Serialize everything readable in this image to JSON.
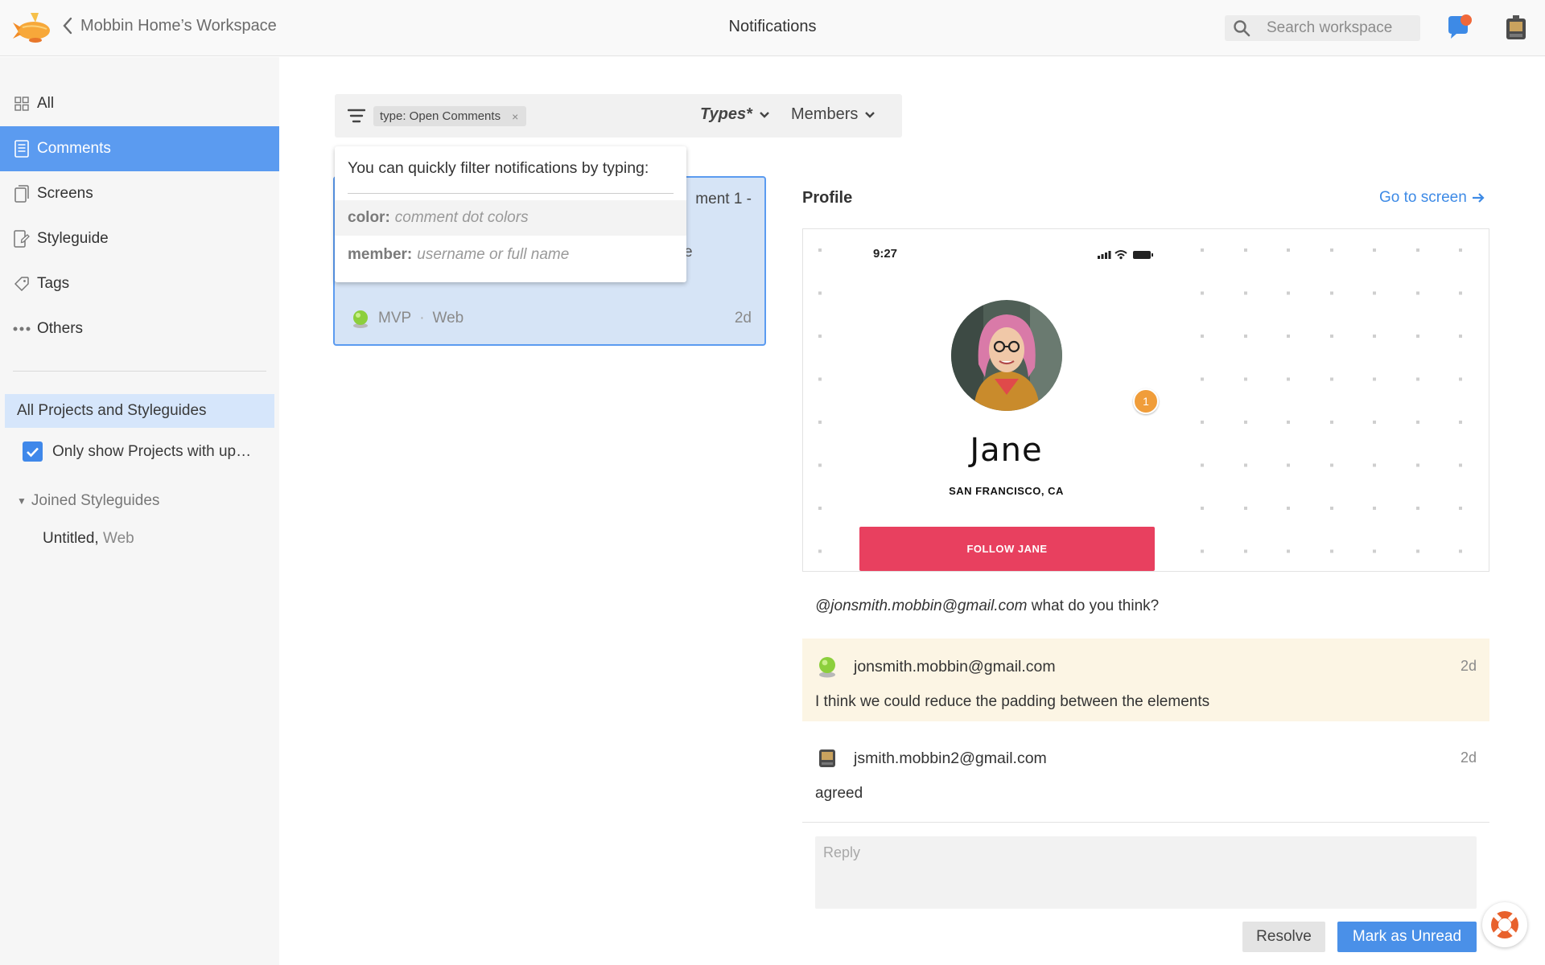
{
  "topbar": {
    "back_label": "Mobbin Home’s Workspace",
    "title": "Notifications",
    "search_placeholder": "Search workspace"
  },
  "sidebar": {
    "items": [
      {
        "label": "All",
        "icon": "grid-icon"
      },
      {
        "label": "Comments",
        "icon": "document-icon",
        "active": true
      },
      {
        "label": "Screens",
        "icon": "screens-icon"
      },
      {
        "label": "Styleguide",
        "icon": "styleguide-icon"
      },
      {
        "label": "Tags",
        "icon": "tag-icon"
      },
      {
        "label": "Others",
        "icon": "more-icon"
      }
    ],
    "projects_button": "All Projects and Styleguides",
    "only_show": "Only show Projects with up…",
    "joined_label": "Joined Styleguides",
    "styleguide_name": "Untitled,",
    "styleguide_platform": " Web"
  },
  "filter": {
    "chip": "type: Open Comments",
    "chip_close": "×",
    "types_label": "Types*",
    "members_label": "Members"
  },
  "hint": {
    "title": "You can quickly filter notifications by typing:",
    "rows": [
      {
        "key": "color:",
        "desc": "comment dot colors"
      },
      {
        "key": "member:",
        "desc": "username or full name"
      }
    ]
  },
  "card": {
    "title_fragment": "ment 1 -",
    "text_fragment": "e",
    "project": "MVP",
    "separator": "·",
    "platform": "Web",
    "age": "2d"
  },
  "detail": {
    "screen_name": "Profile",
    "goto_label": "Go to screen",
    "preview": {
      "time": "9:27",
      "name": "Jane",
      "location": "SAN FRANCISCO, CA",
      "follow_label": "FOLLOW JANE",
      "badge": "1"
    },
    "mention_user": "@jonsmith.mobbin@gmail.com",
    "mention_text": " what do you think?",
    "comments": [
      {
        "author": "jonsmith.mobbin@gmail.com",
        "age": "2d",
        "text": "I think we could reduce the padding between the elements"
      },
      {
        "author": "jsmith.mobbin2@gmail.com",
        "age": "2d",
        "text": "agreed"
      }
    ],
    "reply_placeholder": "Reply",
    "resolve_label": "Resolve",
    "unread_label": "Mark as Unread"
  },
  "colors": {
    "accent": "#5b9bf0",
    "follow": "#e8405f",
    "comment_highlight": "#fcf5e4",
    "badge": "#f09d3a"
  }
}
